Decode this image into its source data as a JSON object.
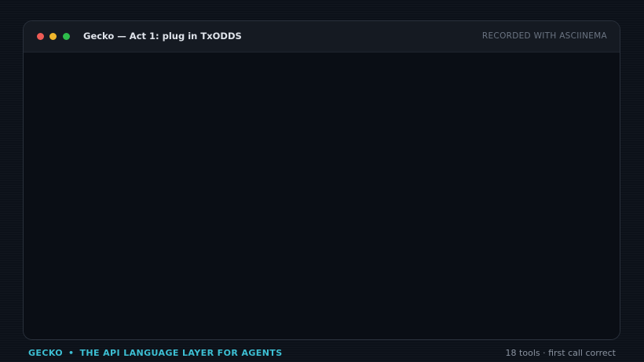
{
  "window": {
    "title": "Gecko — Act 1: plug in TxODDS",
    "recorded_label": "RECORDED WITH ASCIINEMA",
    "controls": {
      "close_color": "#ee5b55",
      "minimize_color": "#f0b62c",
      "maximize_color": "#2ebd4b"
    }
  },
  "footer": {
    "brand": "GECKO",
    "separator": "•",
    "tagline": "THE API LANGUAGE LAYER FOR AGENTS",
    "meta": "18 tools · first call correct"
  },
  "colors": {
    "background": "#0c1119",
    "terminal_background": "#0a0e15",
    "titlebar_background": "#151a22",
    "accent": "#3dbfd3"
  }
}
